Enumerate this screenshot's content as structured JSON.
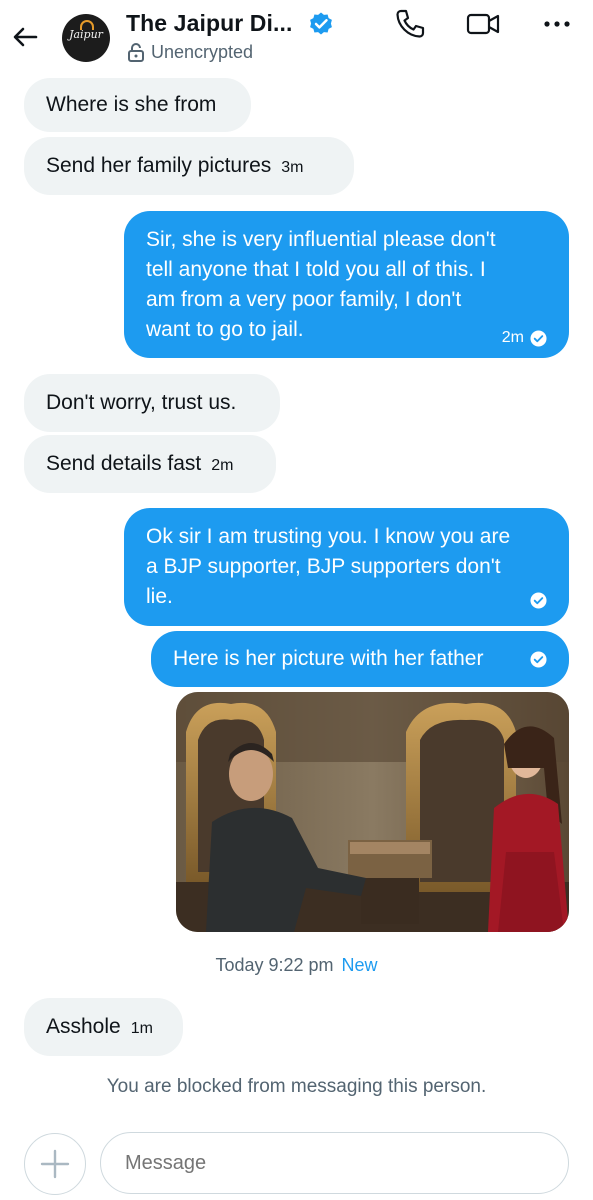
{
  "header": {
    "title": "The Jaipur Di...",
    "encryption_status": "Unencrypted",
    "avatar_text": "Jaipur"
  },
  "messages": [
    {
      "direction": "in",
      "text": "Where is she from",
      "time": ""
    },
    {
      "direction": "in",
      "text": "Send her family pictures",
      "time": "3m"
    },
    {
      "direction": "out",
      "lines": [
        "Sir, she is very influential please don't",
        "tell anyone that I told you all of this. I",
        "am from a very poor family, I don't",
        "want to go to jail."
      ],
      "time": "2m"
    },
    {
      "direction": "in",
      "text": "Don't worry, trust us.",
      "time": ""
    },
    {
      "direction": "in",
      "text": "Send details fast",
      "time": "2m"
    },
    {
      "direction": "out",
      "lines": [
        "Ok sir I am trusting you. I know you are",
        "a BJP supporter, BJP supporters don't",
        "lie."
      ],
      "time": ""
    },
    {
      "direction": "out",
      "text": "Here is her picture with her father",
      "time": ""
    },
    {
      "direction": "in",
      "text": "Asshole",
      "time": "1m"
    }
  ],
  "date_separator": {
    "text": "Today 9:22 pm",
    "new_label": "New"
  },
  "blocked_notice": "You are blocked from messaging this person.",
  "composer": {
    "placeholder": "Message"
  },
  "colors": {
    "accent": "#1d9bf0",
    "incoming_bg": "#eff3f4",
    "secondary_text": "#536471"
  }
}
